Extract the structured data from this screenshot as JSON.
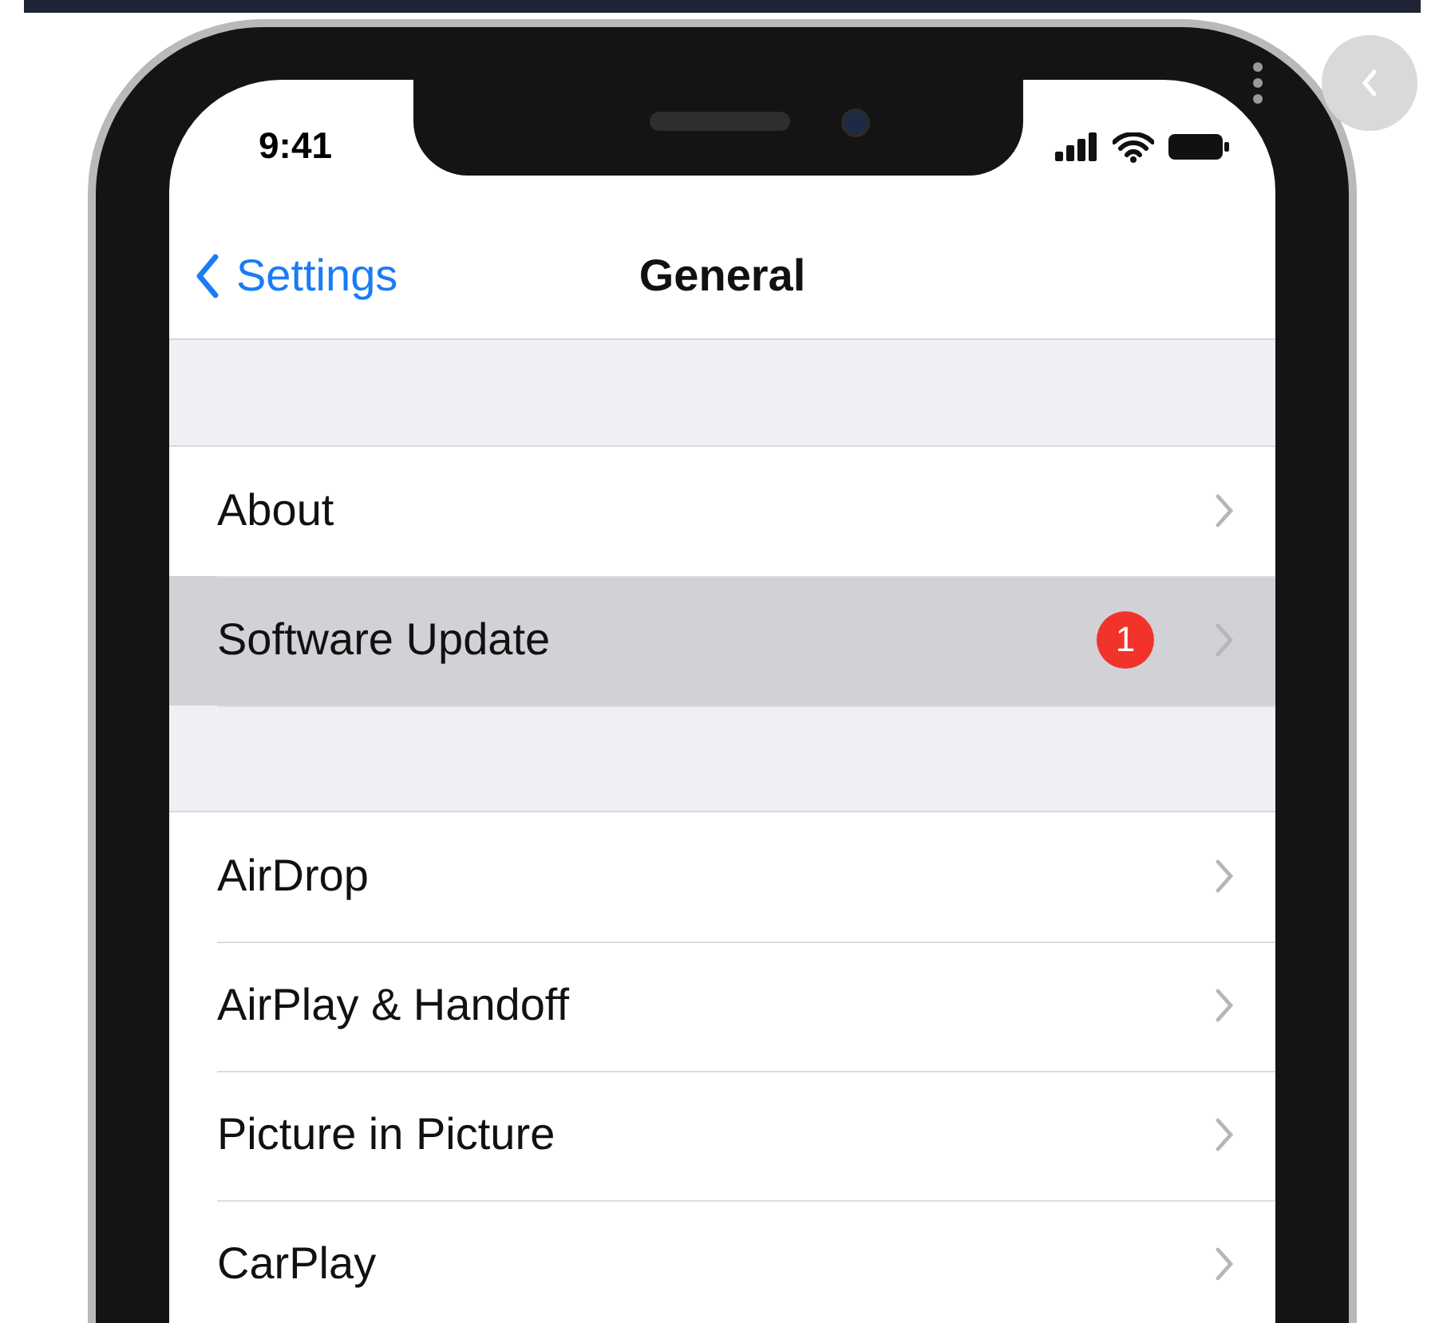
{
  "status_bar": {
    "time": "9:41"
  },
  "nav": {
    "back": "Settings",
    "title": "General"
  },
  "groups": [
    {
      "rows": [
        {
          "label": "About",
          "selected": false
        },
        {
          "label": "Software Update",
          "selected": true,
          "badge": "1"
        }
      ]
    },
    {
      "rows": [
        {
          "label": "AirDrop",
          "selected": false
        },
        {
          "label": "AirPlay & Handoff",
          "selected": false
        },
        {
          "label": "Picture in Picture",
          "selected": false
        },
        {
          "label": "CarPlay",
          "selected": false
        }
      ]
    }
  ]
}
